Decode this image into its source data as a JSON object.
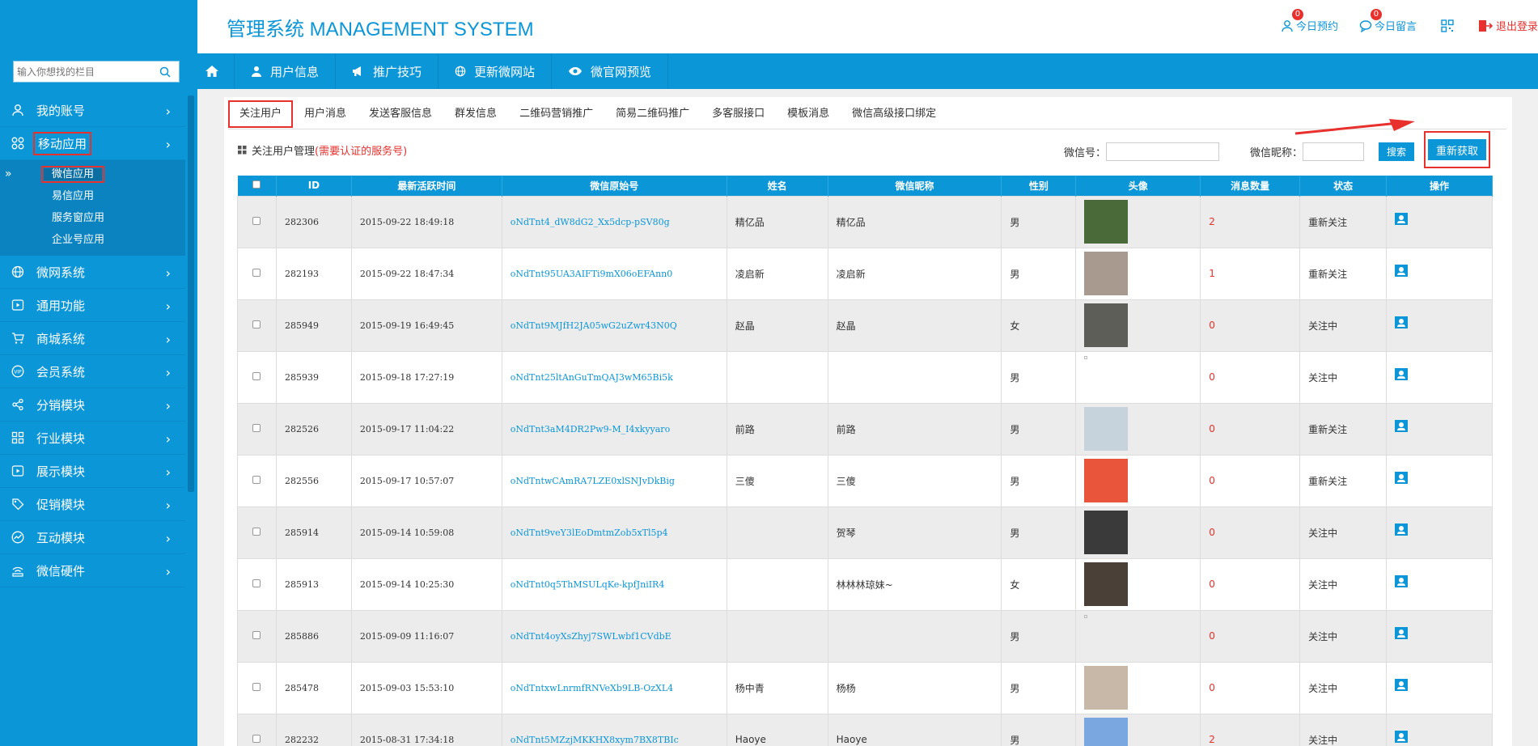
{
  "header": {
    "title": "管理系统 MANAGEMENT SYSTEM",
    "links": [
      {
        "label": "今日预约",
        "badge": "0",
        "icon": "user-icon"
      },
      {
        "label": "今日留言",
        "badge": "0",
        "icon": "chat-icon"
      },
      {
        "label": "",
        "badge": "",
        "icon": "qrcode-icon"
      },
      {
        "label": "退出登录",
        "badge": "",
        "icon": "logout-icon"
      }
    ]
  },
  "sidebar": {
    "search_placeholder": "输入你想找的栏目",
    "menu": [
      {
        "label": "我的账号",
        "icon": "user-icon"
      },
      {
        "label": "移动应用",
        "icon": "apps-icon"
      },
      {
        "label": "微网系统",
        "icon": "globe-icon"
      },
      {
        "label": "通用功能",
        "icon": "play-icon"
      },
      {
        "label": "商城系统",
        "icon": "cart-icon"
      },
      {
        "label": "会员系统",
        "icon": "vip-icon"
      },
      {
        "label": "分销模块",
        "icon": "share-icon"
      },
      {
        "label": "行业模块",
        "icon": "grid-icon"
      },
      {
        "label": "展示模块",
        "icon": "play-icon"
      },
      {
        "label": "促销模块",
        "icon": "tag-icon"
      },
      {
        "label": "互动模块",
        "icon": "chart-icon"
      },
      {
        "label": "微信硬件",
        "icon": "wifi-icon"
      }
    ],
    "submenu": [
      "微信应用",
      "易信应用",
      "服务窗应用",
      "企业号应用"
    ],
    "submenu_marker": "»"
  },
  "topnav": {
    "items": [
      "用户信息",
      "推广技巧",
      "更新微网站",
      "微官网预览"
    ]
  },
  "tabs": [
    "关注用户",
    "用户消息",
    "发送客服信息",
    "群发信息",
    "二维码营销推广",
    "简易二维码推广",
    "多客服接口",
    "模板消息",
    "微信高级接口绑定"
  ],
  "panel": {
    "title": "关注用户管理",
    "warning": "(需要认证的服务号)",
    "wechat_id_label": "微信号：",
    "nickname_label": "微信昵称：",
    "search_button": "搜索",
    "refetch_button": "重新获取"
  },
  "table": {
    "columns": [
      "ID",
      "最新活跃时间",
      "微信原始号",
      "姓名",
      "微信昵称",
      "性别",
      "头像",
      "消息数量",
      "状态",
      "操作"
    ],
    "rows": [
      {
        "id": "282306",
        "time": "2015-09-22 18:49:18",
        "openid": "oNdTnt4_dW8dG2_Xx5dcp-pSV80g",
        "name": "精亿品",
        "nickname": "精亿品",
        "gender": "男",
        "avatar": "#4a6a3a",
        "count": "2",
        "status": "重新关注"
      },
      {
        "id": "282193",
        "time": "2015-09-22 18:47:34",
        "openid": "oNdTnt95UA3AIFTi9mX06oEFAnn0",
        "name": "凌启新",
        "nickname": "凌启新",
        "gender": "男",
        "avatar": "#a89a8e",
        "count": "1",
        "status": "重新关注"
      },
      {
        "id": "285949",
        "time": "2015-09-19 16:49:45",
        "openid": "oNdTnt9MJfH2JA05wG2uZwr43N0Q",
        "name": "赵晶",
        "nickname": "赵晶",
        "gender": "女",
        "avatar": "#5e5e58",
        "count": "0",
        "status": "关注中"
      },
      {
        "id": "285939",
        "time": "2015-09-18 17:27:19",
        "openid": "oNdTnt25ltAnGuTmQAJ3wM65Bi5k",
        "name": "",
        "nickname": "",
        "gender": "男",
        "avatar": "",
        "count": "0",
        "status": "关注中"
      },
      {
        "id": "282526",
        "time": "2015-09-17 11:04:22",
        "openid": "oNdTnt3aM4DR2Pw9-M_I4xkyyaro",
        "name": "前路",
        "nickname": "前路",
        "gender": "男",
        "avatar": "#c7d3dc",
        "count": "0",
        "status": "重新关注"
      },
      {
        "id": "282556",
        "time": "2015-09-17 10:57:07",
        "openid": "oNdTntwCAmRA7LZE0xlSNJvDkBig",
        "name": "三傻",
        "nickname": "三傻",
        "gender": "男",
        "avatar": "#e8553a",
        "count": "0",
        "status": "重新关注"
      },
      {
        "id": "285914",
        "time": "2015-09-14 10:59:08",
        "openid": "oNdTnt9veY3lEoDmtmZob5xTl5p4",
        "name": "",
        "nickname": "贺琴",
        "gender": "男",
        "avatar": "#3a3a3a",
        "count": "0",
        "status": "关注中"
      },
      {
        "id": "285913",
        "time": "2015-09-14 10:25:30",
        "openid": "oNdTnt0q5ThMSULqKe-kpfJniIR4",
        "name": "",
        "nickname": "林林林琼妹~",
        "gender": "女",
        "avatar": "#4a4038",
        "count": "0",
        "status": "关注中"
      },
      {
        "id": "285886",
        "time": "2015-09-09 11:16:07",
        "openid": "oNdTnt4oyXsZhyj7SWLwbf1CVdbE",
        "name": "",
        "nickname": "",
        "gender": "男",
        "avatar": "",
        "count": "0",
        "status": "关注中"
      },
      {
        "id": "285478",
        "time": "2015-09-03 15:53:10",
        "openid": "oNdTntxwLnrmfRNVeXb9LB-OzXL4",
        "name": "杨中青",
        "nickname": "杨杨",
        "gender": "男",
        "avatar": "#c8b8a8",
        "count": "0",
        "status": "关注中"
      },
      {
        "id": "282232",
        "time": "2015-08-31 17:34:18",
        "openid": "oNdTnt5MZzjMKKHX8xym7BX8TBIc",
        "name": "Haoye",
        "nickname": "Haoye",
        "gender": "男",
        "avatar": "#7aa7e0",
        "count": "2",
        "status": "关注中"
      }
    ]
  },
  "colors": {
    "accent": "#0b96d8",
    "alert": "#e8302c"
  }
}
